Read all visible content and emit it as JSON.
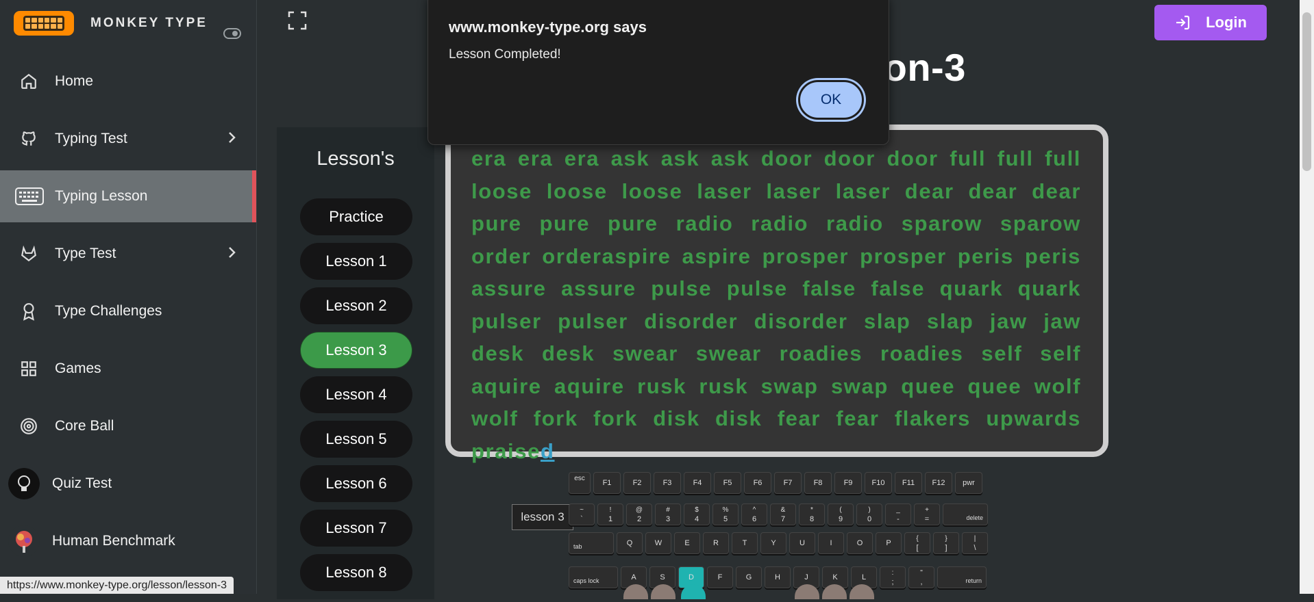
{
  "brand": {
    "name": "MONKEY TYPE"
  },
  "sidebar": {
    "items": [
      {
        "label": "Home",
        "icon": "home-icon",
        "has_arrow": false
      },
      {
        "label": "Typing Test",
        "icon": "github-icon",
        "has_arrow": true
      },
      {
        "label": "Typing Lesson",
        "icon": "keyboard-icon",
        "has_arrow": false,
        "active": true
      },
      {
        "label": "Type Test",
        "icon": "gitlab-icon",
        "has_arrow": true
      },
      {
        "label": "Type Challenges",
        "icon": "award-icon",
        "has_arrow": false
      },
      {
        "label": "Games",
        "icon": "grid-icon",
        "has_arrow": false
      },
      {
        "label": "Core Ball",
        "icon": "target-icon",
        "has_arrow": false
      },
      {
        "label": "Quiz Test",
        "icon": "avatar-bulb",
        "has_arrow": false
      },
      {
        "label": "Human Benchmark",
        "icon": "avatar-brain",
        "has_arrow": false
      }
    ]
  },
  "header": {
    "title": "son-3",
    "login_label": "Login"
  },
  "lessons": {
    "title": "Lesson's",
    "items": [
      "Practice",
      "Lesson 1",
      "Lesson 2",
      "Lesson 3",
      "Lesson 4",
      "Lesson 5",
      "Lesson 6",
      "Lesson 7",
      "Lesson 8"
    ],
    "active_index": 3
  },
  "typing": {
    "text": "era era era ask ask ask door door door full full full loose loose loose laser laser laser dear dear dear pure pure pure radio radio radio sparow sparow order orderaspire aspire prosper prosper peris peris assure assure pulse pulse false false quark quark pulser pulser disorder disorder slap slap jaw jaw desk desk swear swear roadies roadies self self aquire aquire rusk rusk swap swap quee quee wolf wolf fork fork disk disk fear fear flakers upwards praise",
    "cursor_char": "d",
    "typed_color": "#3e9a4a",
    "cursor_color": "#3aa0c8"
  },
  "keyboard": {
    "tag": "lesson 3",
    "fn_row": [
      "esc",
      "F1",
      "F2",
      "F3",
      "F4",
      "F5",
      "F6",
      "F7",
      "F8",
      "F9",
      "F10",
      "F11",
      "F12",
      "pwr"
    ],
    "num_row": [
      [
        "~",
        "`"
      ],
      [
        "!",
        "1"
      ],
      [
        "@",
        "2"
      ],
      [
        "#",
        "3"
      ],
      [
        "$",
        "4"
      ],
      [
        "%",
        "5"
      ],
      [
        "^",
        "6"
      ],
      [
        "&",
        "7"
      ],
      [
        "*",
        "8"
      ],
      [
        "(",
        "9"
      ],
      [
        ")",
        "0"
      ],
      [
        "_",
        "-"
      ],
      [
        "+",
        "="
      ]
    ],
    "delete": "delete",
    "tab": "tab",
    "top_row": [
      "Q",
      "W",
      "E",
      "R",
      "T",
      "Y",
      "U",
      "I",
      "O",
      "P"
    ],
    "top_pairs": [
      [
        "{",
        "["
      ],
      [
        "}",
        "]"
      ],
      [
        "|",
        "\\"
      ]
    ],
    "caps": "caps lock",
    "home_row": [
      "A",
      "S",
      "D",
      "F",
      "G",
      "H",
      "J",
      "K",
      "L"
    ],
    "home_pairs": [
      [
        ":",
        ";"
      ],
      [
        "\"",
        ","
      ]
    ],
    "return": "return",
    "highlighted": "D"
  },
  "dialog": {
    "title": "www.monkey-type.org says",
    "message": "Lesson Completed!",
    "ok_label": "OK"
  },
  "status": {
    "url": "https://www.monkey-type.org/lesson/lesson-3"
  },
  "colors": {
    "accent": "#a45af0",
    "active_lesson": "#3c9a49",
    "active_marker": "#e0535a"
  }
}
